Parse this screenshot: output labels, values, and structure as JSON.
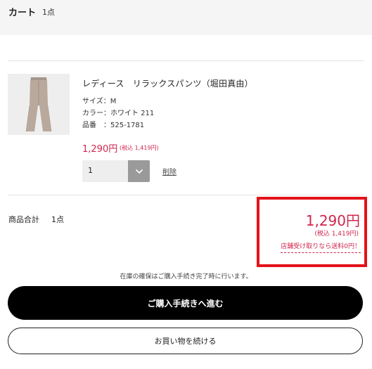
{
  "header": {
    "title": "カート",
    "count": "1点"
  },
  "item": {
    "name": "レディース　リラックスパンツ（堀田真由）",
    "specs": [
      "サイズ：M",
      "カラー：ホワイト 211",
      "品番　：525-1781"
    ],
    "price": "1,290円",
    "price_tax": "(税込 1,419円)",
    "quantity": "1",
    "delete_label": "削除"
  },
  "summary": {
    "label": "商品合計",
    "count": "1点",
    "total": "1,290円",
    "total_tax": "(税込 1,419円)",
    "pickup_note": "店舗受け取りなら送料0円！",
    "highlight_color": "#e4121b"
  },
  "footer": {
    "stock_note": "在庫の確保はご購入手続き完了時に行います。",
    "purchase_label": "ご購入手続きへ進む",
    "continue_label": "お買い物を続ける"
  },
  "colors": {
    "price": "#d0254c",
    "primary_button": "#000000"
  }
}
